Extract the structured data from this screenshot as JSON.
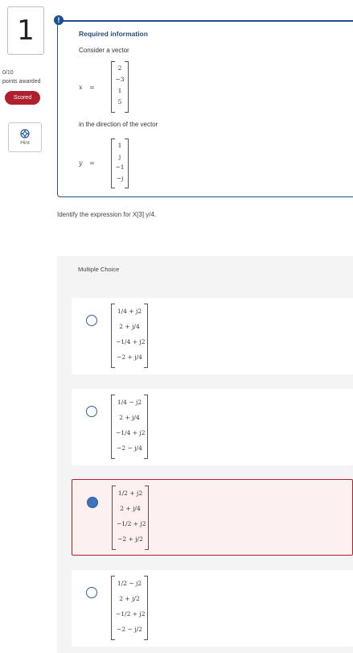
{
  "question": {
    "number": "1",
    "points": "0/10",
    "points_label": "points awarded",
    "scored_label": "Scored",
    "hint_label": "Hint",
    "prompt": "Identify the expression for X[3] y/4."
  },
  "info": {
    "alert_glyph": "!",
    "title": "Required information",
    "intro": "Consider a vector",
    "x_label": "x",
    "x_values": [
      "2",
      "−3",
      "1",
      "5"
    ],
    "direction_text": "in the direction of the vector",
    "y_label": "y",
    "y_values": [
      "1",
      "j",
      "−1",
      "−j"
    ],
    "equals": "="
  },
  "multiple_choice": {
    "title": "Multiple Choice",
    "choices": [
      {
        "selected": false,
        "entries": [
          "1/4 + j2",
          "2 + j/4",
          "−1/4 + j2",
          "−2 + j/4"
        ]
      },
      {
        "selected": false,
        "entries": [
          "1/4 − j2",
          "2 + j/4",
          "−1/4 + j2",
          "−2 − j/4"
        ]
      },
      {
        "selected": true,
        "entries": [
          "1/2 + j2",
          "2 + j/4",
          "−1/2 + j2",
          "−2 + j/2"
        ]
      },
      {
        "selected": false,
        "entries": [
          "1/2 − j2",
          "2 + j/2",
          "−1/2 + j2",
          "−2 − j/2"
        ]
      }
    ]
  },
  "colors": {
    "accent_blue": "#1d4e8f",
    "scored_red": "#b01f2d",
    "selected_bg": "#fdf0f0",
    "radio_fill": "#3e74bb"
  },
  "icons": {
    "hint": "lifebuoy-icon",
    "alert": "exclamation-icon"
  }
}
